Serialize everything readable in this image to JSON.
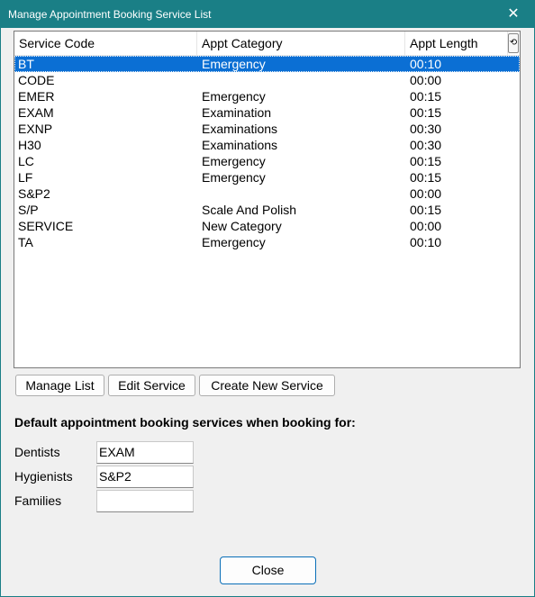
{
  "window": {
    "title": "Manage Appointment Booking Service List",
    "close_glyph": "✕"
  },
  "list": {
    "columns": [
      "Service Code",
      "Appt Category",
      "Appt Length"
    ],
    "header_scroll_glyph": "⟲",
    "selected_index": 0,
    "rows": [
      {
        "code": "BT",
        "category": "Emergency",
        "length": "00:10"
      },
      {
        "code": "CODE",
        "category": "",
        "length": "00:00"
      },
      {
        "code": "EMER",
        "category": "Emergency",
        "length": "00:15"
      },
      {
        "code": "EXAM",
        "category": "Examination",
        "length": "00:15"
      },
      {
        "code": "EXNP",
        "category": "Examinations",
        "length": "00:30"
      },
      {
        "code": "H30",
        "category": "Examinations",
        "length": "00:30"
      },
      {
        "code": "LC",
        "category": "Emergency",
        "length": "00:15"
      },
      {
        "code": "LF",
        "category": "Emergency",
        "length": "00:15"
      },
      {
        "code": "S&P2",
        "category": "",
        "length": "00:00"
      },
      {
        "code": "S/P",
        "category": "Scale And Polish",
        "length": "00:15"
      },
      {
        "code": "SERVICE",
        "category": "New Category",
        "length": "00:00"
      },
      {
        "code": "TA",
        "category": "Emergency",
        "length": "00:10"
      }
    ]
  },
  "buttons": {
    "manage_list": "Manage List",
    "edit_service": "Edit Service",
    "create_new_service": "Create New Service",
    "close": "Close"
  },
  "defaults": {
    "heading": "Default appointment booking services when booking for:",
    "dentists_label": "Dentists",
    "dentists_value": "EXAM",
    "hygienists_label": "Hygienists",
    "hygienists_value": "S&P2",
    "families_label": "Families",
    "families_value": ""
  },
  "colors": {
    "titlebar": "#1a7f86",
    "selection": "#0b6fd4"
  }
}
